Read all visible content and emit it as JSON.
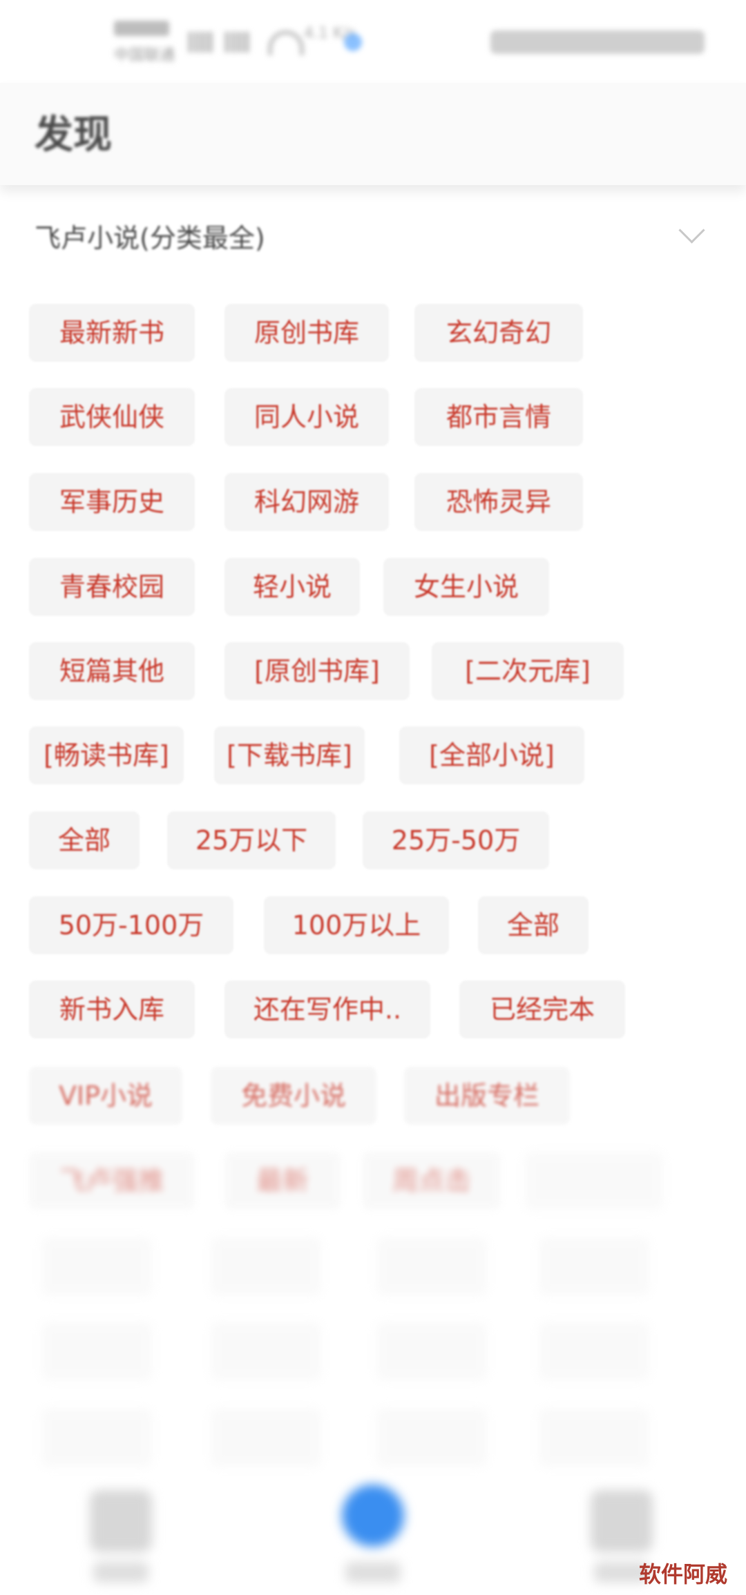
{
  "status_bar": {
    "carrier": "中国联通",
    "speed": "4.1 K/s"
  },
  "header": {
    "title": "发现"
  },
  "source": {
    "label": "飞卢小说(分类最全)"
  },
  "categories": [
    "最新新书",
    "原创书库",
    "玄幻奇幻",
    "武侠仙侠",
    "同人小说",
    "都市言情",
    "军事历史",
    "科幻网游",
    "恐怖灵异",
    "青春校园",
    "轻小说",
    "女生小说",
    "短篇其他",
    "[原创书库]",
    "[二次元库]",
    "[畅读书库]",
    "[下载书库]",
    "[全部小说]",
    "全部",
    "25万以下",
    "25万-50万",
    "50万-100万",
    "100万以上",
    "全部",
    "新书入库",
    "还在写作中..",
    "已经完本",
    "VIP小说",
    "免费小说",
    "出版专栏",
    "飞卢强推",
    "最新",
    "周点击",
    ""
  ],
  "tabs": [
    "书架",
    "发现",
    "我的"
  ],
  "watermark": "软件阿威"
}
